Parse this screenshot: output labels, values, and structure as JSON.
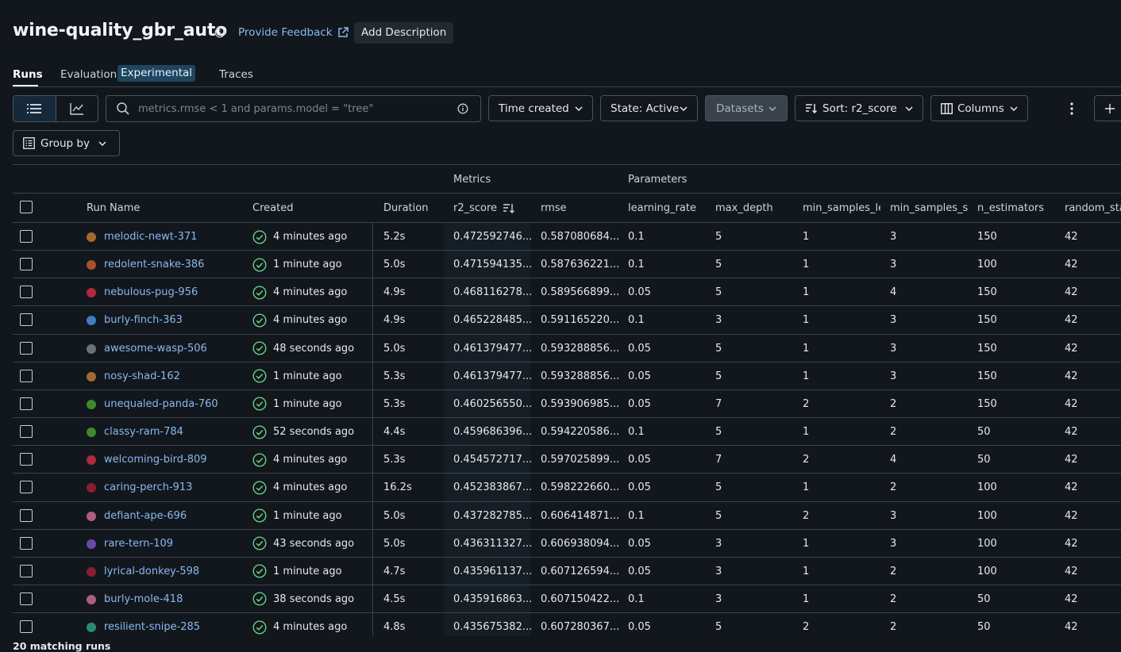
{
  "header": {
    "title": "wine-quality_gbr_auto",
    "feedback_label": "Provide Feedback",
    "add_description_label": "Add Description"
  },
  "tabs": {
    "runs": "Runs",
    "evaluation": "Evaluation",
    "experimental_badge": "Experimental",
    "traces": "Traces"
  },
  "toolbar": {
    "search_placeholder": "metrics.rmse < 1 and params.model = \"tree\"",
    "time_created": "Time created",
    "state": "State: Active",
    "datasets": "Datasets",
    "sort": "Sort: r2_score",
    "columns": "Columns",
    "group_by": "Group by"
  },
  "table": {
    "group_headers": {
      "metrics": "Metrics",
      "parameters": "Parameters"
    },
    "columns": [
      "Run Name",
      "Created",
      "Duration",
      "r2_score",
      "rmse",
      "learning_rate",
      "max_depth",
      "min_samples_lea",
      "min_samples_sp",
      "n_estimators",
      "random_sta"
    ],
    "rows": [
      {
        "name": "melodic-newt-371",
        "color": "#a36a2e",
        "created": "4 minutes ago",
        "duration": "5.2s",
        "r2": "0.472592746...",
        "rmse": "0.587080684...",
        "lr": "0.1",
        "depth": "5",
        "leaf": "1",
        "split": "3",
        "n_est": "150",
        "rs": "42"
      },
      {
        "name": "redolent-snake-386",
        "color": "#a8502e",
        "created": "1 minute ago",
        "duration": "5.0s",
        "r2": "0.471594135...",
        "rmse": "0.587636221...",
        "lr": "0.1",
        "depth": "5",
        "leaf": "1",
        "split": "3",
        "n_est": "100",
        "rs": "42"
      },
      {
        "name": "nebulous-pug-956",
        "color": "#b02a40",
        "created": "4 minutes ago",
        "duration": "4.9s",
        "r2": "0.468116278...",
        "rmse": "0.589566899...",
        "lr": "0.05",
        "depth": "5",
        "leaf": "1",
        "split": "4",
        "n_est": "150",
        "rs": "42"
      },
      {
        "name": "burly-finch-363",
        "color": "#3e7ec0",
        "created": "4 minutes ago",
        "duration": "4.9s",
        "r2": "0.465228485...",
        "rmse": "0.591165220...",
        "lr": "0.1",
        "depth": "3",
        "leaf": "1",
        "split": "3",
        "n_est": "150",
        "rs": "42"
      },
      {
        "name": "awesome-wasp-506",
        "color": "#6b7278",
        "created": "48 seconds ago",
        "duration": "5.0s",
        "r2": "0.461379477...",
        "rmse": "0.593288856...",
        "lr": "0.05",
        "depth": "5",
        "leaf": "1",
        "split": "3",
        "n_est": "150",
        "rs": "42"
      },
      {
        "name": "nosy-shad-162",
        "color": "#a36a2e",
        "created": "1 minute ago",
        "duration": "5.3s",
        "r2": "0.461379477...",
        "rmse": "0.593288856...",
        "lr": "0.05",
        "depth": "5",
        "leaf": "1",
        "split": "3",
        "n_est": "150",
        "rs": "42"
      },
      {
        "name": "unequaled-panda-760",
        "color": "#3f8a2c",
        "created": "1 minute ago",
        "duration": "5.3s",
        "r2": "0.460256550...",
        "rmse": "0.593906985...",
        "lr": "0.05",
        "depth": "7",
        "leaf": "2",
        "split": "2",
        "n_est": "150",
        "rs": "42"
      },
      {
        "name": "classy-ram-784",
        "color": "#3f8a2c",
        "created": "52 seconds ago",
        "duration": "4.4s",
        "r2": "0.459686396...",
        "rmse": "0.594220586...",
        "lr": "0.1",
        "depth": "5",
        "leaf": "1",
        "split": "2",
        "n_est": "50",
        "rs": "42"
      },
      {
        "name": "welcoming-bird-809",
        "color": "#b02a40",
        "created": "4 minutes ago",
        "duration": "5.3s",
        "r2": "0.454572717...",
        "rmse": "0.597025899...",
        "lr": "0.05",
        "depth": "7",
        "leaf": "2",
        "split": "4",
        "n_est": "50",
        "rs": "42"
      },
      {
        "name": "caring-perch-913",
        "color": "#8a1e30",
        "created": "4 minutes ago",
        "duration": "16.2s",
        "r2": "0.452383867...",
        "rmse": "0.598222660...",
        "lr": "0.05",
        "depth": "5",
        "leaf": "1",
        "split": "2",
        "n_est": "100",
        "rs": "42"
      },
      {
        "name": "defiant-ape-696",
        "color": "#b05a86",
        "created": "1 minute ago",
        "duration": "5.0s",
        "r2": "0.437282785...",
        "rmse": "0.606414871...",
        "lr": "0.1",
        "depth": "5",
        "leaf": "2",
        "split": "3",
        "n_est": "100",
        "rs": "42"
      },
      {
        "name": "rare-tern-109",
        "color": "#6a4aa6",
        "created": "43 seconds ago",
        "duration": "5.0s",
        "r2": "0.436311327...",
        "rmse": "0.606938094...",
        "lr": "0.05",
        "depth": "3",
        "leaf": "1",
        "split": "3",
        "n_est": "100",
        "rs": "42"
      },
      {
        "name": "lyrical-donkey-598",
        "color": "#8a1e30",
        "created": "1 minute ago",
        "duration": "4.7s",
        "r2": "0.435961137...",
        "rmse": "0.607126594...",
        "lr": "0.05",
        "depth": "3",
        "leaf": "1",
        "split": "2",
        "n_est": "100",
        "rs": "42"
      },
      {
        "name": "burly-mole-418",
        "color": "#b05a86",
        "created": "38 seconds ago",
        "duration": "4.5s",
        "r2": "0.435916863...",
        "rmse": "0.607150422...",
        "lr": "0.1",
        "depth": "3",
        "leaf": "1",
        "split": "2",
        "n_est": "50",
        "rs": "42"
      },
      {
        "name": "resilient-snipe-285",
        "color": "#2a8a78",
        "created": "4 minutes ago",
        "duration": "4.8s",
        "r2": "0.435675382...",
        "rmse": "0.607280367...",
        "lr": "0.05",
        "depth": "5",
        "leaf": "2",
        "split": "2",
        "n_est": "50",
        "rs": "42"
      }
    ]
  },
  "footer": {
    "matching_runs": "20 matching runs"
  }
}
